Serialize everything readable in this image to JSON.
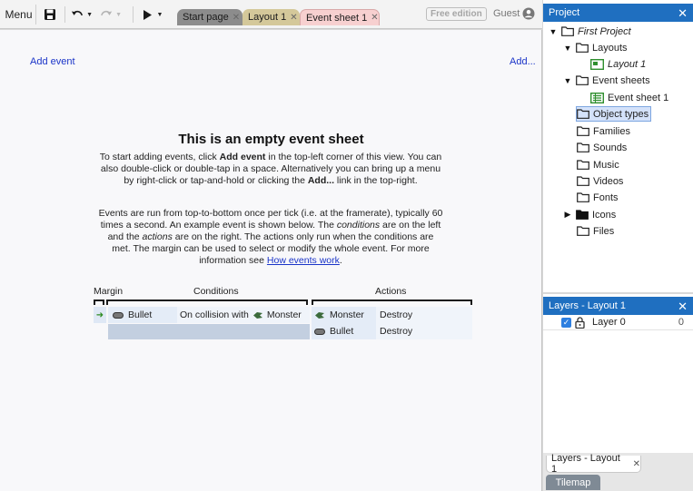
{
  "toolbar": {
    "menu_label": "Menu",
    "free_edition_label": "Free edition",
    "user_label": "Guest"
  },
  "tabs": [
    {
      "label": "Start page"
    },
    {
      "label": "Layout 1"
    },
    {
      "label": "Event sheet 1"
    }
  ],
  "sheet": {
    "add_event_label": "Add event",
    "add_more_label": "Add...",
    "title": "This is an empty event sheet",
    "para1_a": "To start adding events, click ",
    "para1_b": "Add event",
    "para1_c": " in the top-left corner of this view. You can also double-click or double-tap in a space. Alternatively you can bring up a menu by right-click or tap-and-hold or clicking the ",
    "para1_d": "Add...",
    "para1_e": " link in the top-right.",
    "para2_a": "Events are run from top-to-bottom once per tick (i.e. at the framerate), typically 60 times a second. An example event is shown below. The ",
    "para2_b": "conditions",
    "para2_c": " are on the left and the ",
    "para2_d": "actions",
    "para2_e": " are on the right. The actions only run when the conditions are met. The margin can be used to select or modify the whole event. For more information see ",
    "para2_link": "How events work",
    "para2_f": "."
  },
  "example_event": {
    "headers": {
      "margin": "Margin",
      "conditions": "Conditions",
      "actions": "Actions"
    },
    "condition": {
      "object": "Bullet",
      "text": "On collision with",
      "target": "Monster"
    },
    "actions": [
      {
        "object": "Monster",
        "text": "Destroy"
      },
      {
        "object": "Bullet",
        "text": "Destroy"
      }
    ]
  },
  "project": {
    "title": "Project",
    "items": [
      {
        "label": "First Project",
        "icon": "folder-icon"
      },
      {
        "label": "Layouts",
        "icon": "folder-icon"
      },
      {
        "label": "Layout 1",
        "icon": "layout-icon"
      },
      {
        "label": "Event sheets",
        "icon": "folder-icon"
      },
      {
        "label": "Event sheet 1",
        "icon": "event-sheet-icon"
      },
      {
        "label": "Object types",
        "icon": "folder-icon"
      },
      {
        "label": "Families",
        "icon": "folder-icon"
      },
      {
        "label": "Sounds",
        "icon": "folder-icon"
      },
      {
        "label": "Music",
        "icon": "folder-icon"
      },
      {
        "label": "Videos",
        "icon": "folder-icon"
      },
      {
        "label": "Fonts",
        "icon": "folder-icon"
      },
      {
        "label": "Icons",
        "icon": "folder-filled-icon"
      },
      {
        "label": "Files",
        "icon": "folder-icon"
      }
    ]
  },
  "layers": {
    "title": "Layers - Layout 1",
    "rows": [
      {
        "name": "Layer 0",
        "count": "0"
      }
    ]
  },
  "bottom_tabs": {
    "layers_label": "Layers - Layout 1",
    "tilemap_label": "Tilemap"
  },
  "colors": {
    "panel_header": "#1f6fc0",
    "link": "#1a34c8",
    "tab_event_sheet": "#f7d0d0",
    "tab_layout": "#d4c89a"
  }
}
